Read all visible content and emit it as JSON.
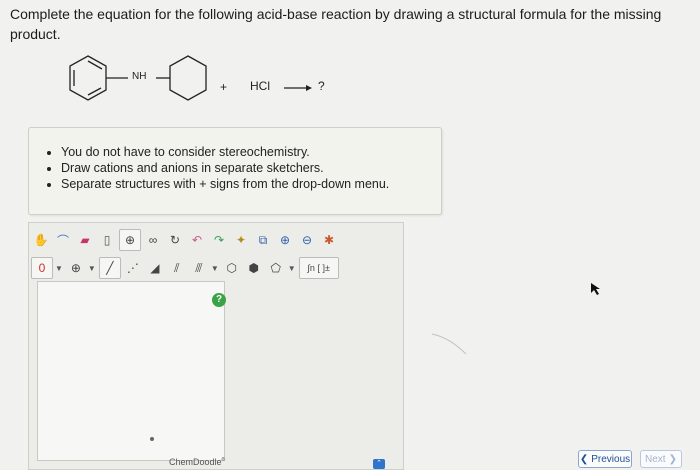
{
  "question": {
    "text": "Complete the equation for the following acid-base reaction by drawing a structural formula for the missing product."
  },
  "reaction": {
    "nh_label": "NH",
    "plus": "+",
    "reagent": "HCl",
    "arrow": "⟶",
    "product": "?"
  },
  "instructions": {
    "items": [
      "You do not have to consider stereochemistry.",
      "Draw cations and anions in separate sketchers.",
      "Separate structures with + signs from the drop-down menu."
    ]
  },
  "sketcher": {
    "charge_value": "0",
    "help_symbol": "?",
    "brand": "ChemDoodle",
    "brand_mark": "®",
    "template_label": "∫n [ ]±"
  },
  "nav": {
    "previous": "Previous",
    "next": "Next"
  }
}
